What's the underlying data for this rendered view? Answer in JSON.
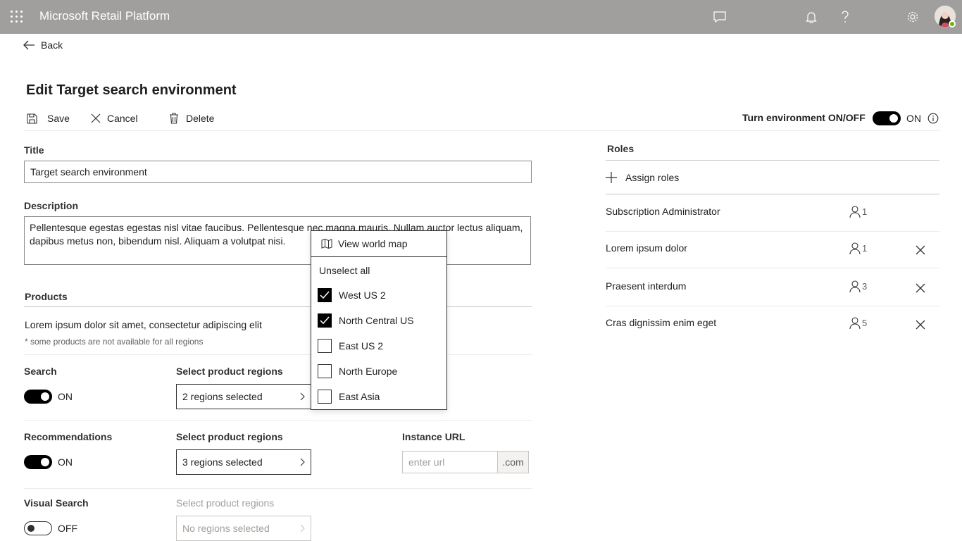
{
  "header": {
    "app_title": "Microsoft Retail Platform",
    "icons": [
      "waffle-icon",
      "chat-icon",
      "bell-icon",
      "help-icon",
      "settings-icon",
      "avatar"
    ]
  },
  "nav": {
    "back_label": "Back"
  },
  "page": {
    "title": "Edit Target search environment"
  },
  "toolbar": {
    "save_label": "Save",
    "cancel_label": "Cancel",
    "delete_label": "Delete"
  },
  "environment_toggle": {
    "label": "Turn environment ON/OFF",
    "state": "ON"
  },
  "form": {
    "title_label": "Title",
    "title_value": "Target search environment",
    "description_label": "Description",
    "description_value": "Pellentesque egestas egestas nisl vitae faucibus. Pellentesque nec magna mauris. Nullam auctor lectus aliquam, dapibus metus non, bibendum nisl. Aliquam a volutpat nisi."
  },
  "products": {
    "section_title": "Products",
    "description": "Lorem ipsum dolor sit amet, consectetur adipiscing elit",
    "note": "* some products are not available for all regions",
    "items": [
      {
        "name": "Search",
        "toggle": "ON",
        "regions_label": "Select product regions",
        "regions_value": "2 regions selected"
      },
      {
        "name": "Recommendations",
        "toggle": "ON",
        "regions_label": "Select product regions",
        "regions_value": "3 regions selected",
        "url_label": "Instance URL",
        "url_placeholder": "enter url",
        "url_suffix": ".com"
      },
      {
        "name": "Visual Search",
        "toggle": "OFF",
        "regions_label": "Select product regions",
        "regions_value": "No regions selected"
      }
    ]
  },
  "region_dropdown": {
    "map_label": "View world map",
    "unselect_label": "Unselect all",
    "options": [
      {
        "label": "West US 2",
        "checked": true
      },
      {
        "label": "North Central US",
        "checked": true
      },
      {
        "label": "East US 2",
        "checked": false
      },
      {
        "label": "North Europe",
        "checked": false
      },
      {
        "label": "East Asia",
        "checked": false
      }
    ]
  },
  "roles": {
    "title": "Roles",
    "assign_label": "Assign roles",
    "items": [
      {
        "name": "Subscription Administrator",
        "count": "1",
        "removable": false
      },
      {
        "name": "Lorem ipsum dolor",
        "count": "1",
        "removable": true
      },
      {
        "name": "Praesent interdum",
        "count": "3",
        "removable": true
      },
      {
        "name": "Cras dignissim enim eget",
        "count": "5",
        "removable": true
      }
    ]
  },
  "colors": {
    "topbar": "#a19f9d",
    "toggle_on": "#000000",
    "presence": "#6bb700"
  }
}
